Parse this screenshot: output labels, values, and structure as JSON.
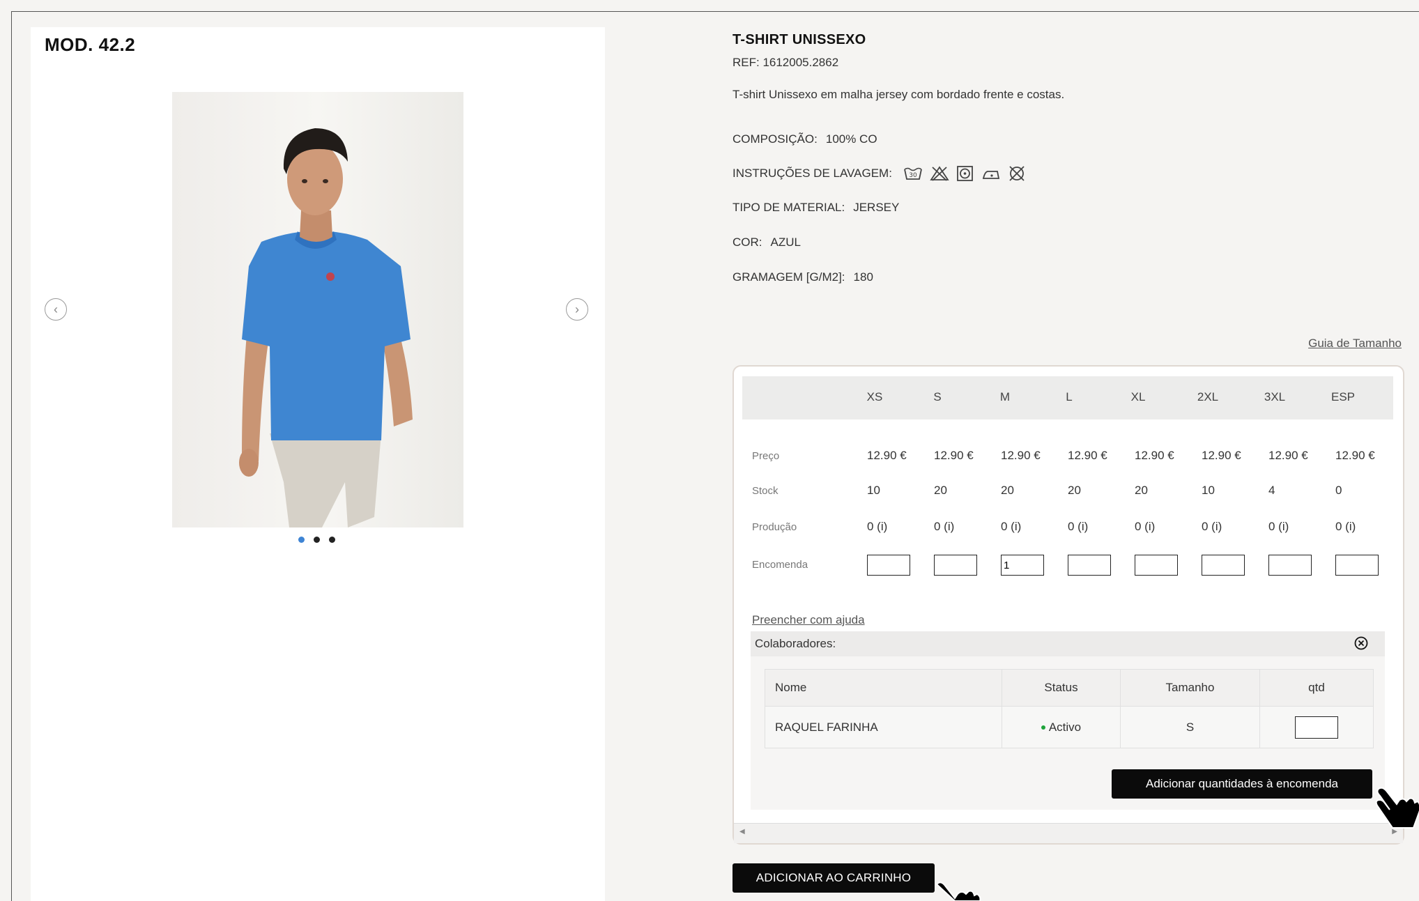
{
  "gallery": {
    "model_title": "MOD. 42.2",
    "prev_icon": "‹",
    "next_icon": "›",
    "dots": 3,
    "active_dot": 0
  },
  "product": {
    "name": "T-SHIRT UNISSEXO",
    "ref": "REF: 1612005.2862",
    "description": "T-shirt Unissexo em malha jersey com bordado frente e costas.",
    "attributes": [
      {
        "label": "COMPOSIÇÃO:",
        "value": "100% CO"
      },
      {
        "label": "INSTRUÇÕES DE LAVAGEM:",
        "value": ""
      },
      {
        "label": "TIPO DE MATERIAL:",
        "value": "JERSEY"
      },
      {
        "label": "COR:",
        "value": "AZUL"
      },
      {
        "label": "GRAMAGEM [G/M2]:",
        "value": "180"
      }
    ],
    "wash_icons": [
      "wash-30-icon",
      "no-bleach-icon",
      "tumble-dry-icon",
      "iron-low-icon",
      "no-dry-clean-icon"
    ],
    "size_guide": "Guia de Tamanho"
  },
  "order_table": {
    "sizes": [
      "XS",
      "S",
      "M",
      "L",
      "XL",
      "2XL",
      "3XL",
      "ESP"
    ],
    "row_labels": {
      "price": "Preço",
      "stock": "Stock",
      "production": "Produção",
      "order": "Encomenda"
    },
    "price": [
      "12.90 €",
      "12.90 €",
      "12.90 €",
      "12.90 €",
      "12.90 €",
      "12.90 €",
      "12.90 €",
      "12.90 €"
    ],
    "stock": [
      "10",
      "20",
      "20",
      "20",
      "20",
      "10",
      "4",
      "0"
    ],
    "production": [
      "0 (i)",
      "0 (i)",
      "0 (i)",
      "0 (i)",
      "0 (i)",
      "0 (i)",
      "0 (i)",
      "0 (i)"
    ],
    "order": [
      "",
      "",
      "1",
      "",
      "",
      "",
      "",
      ""
    ]
  },
  "collaborators": {
    "help_link": "Preencher com ajuda",
    "title": "Colaboradores:",
    "columns": [
      "Nome",
      "Status",
      "Tamanho",
      "qtd"
    ],
    "rows": [
      {
        "name": "RAQUEL FARINHA",
        "status": "Activo",
        "size": "S",
        "qty": ""
      }
    ],
    "status_color": "#1ea33a",
    "add_button": "Adicionar quantidades à encomenda"
  },
  "cart_button": "ADICIONAR AO CARRINHO"
}
